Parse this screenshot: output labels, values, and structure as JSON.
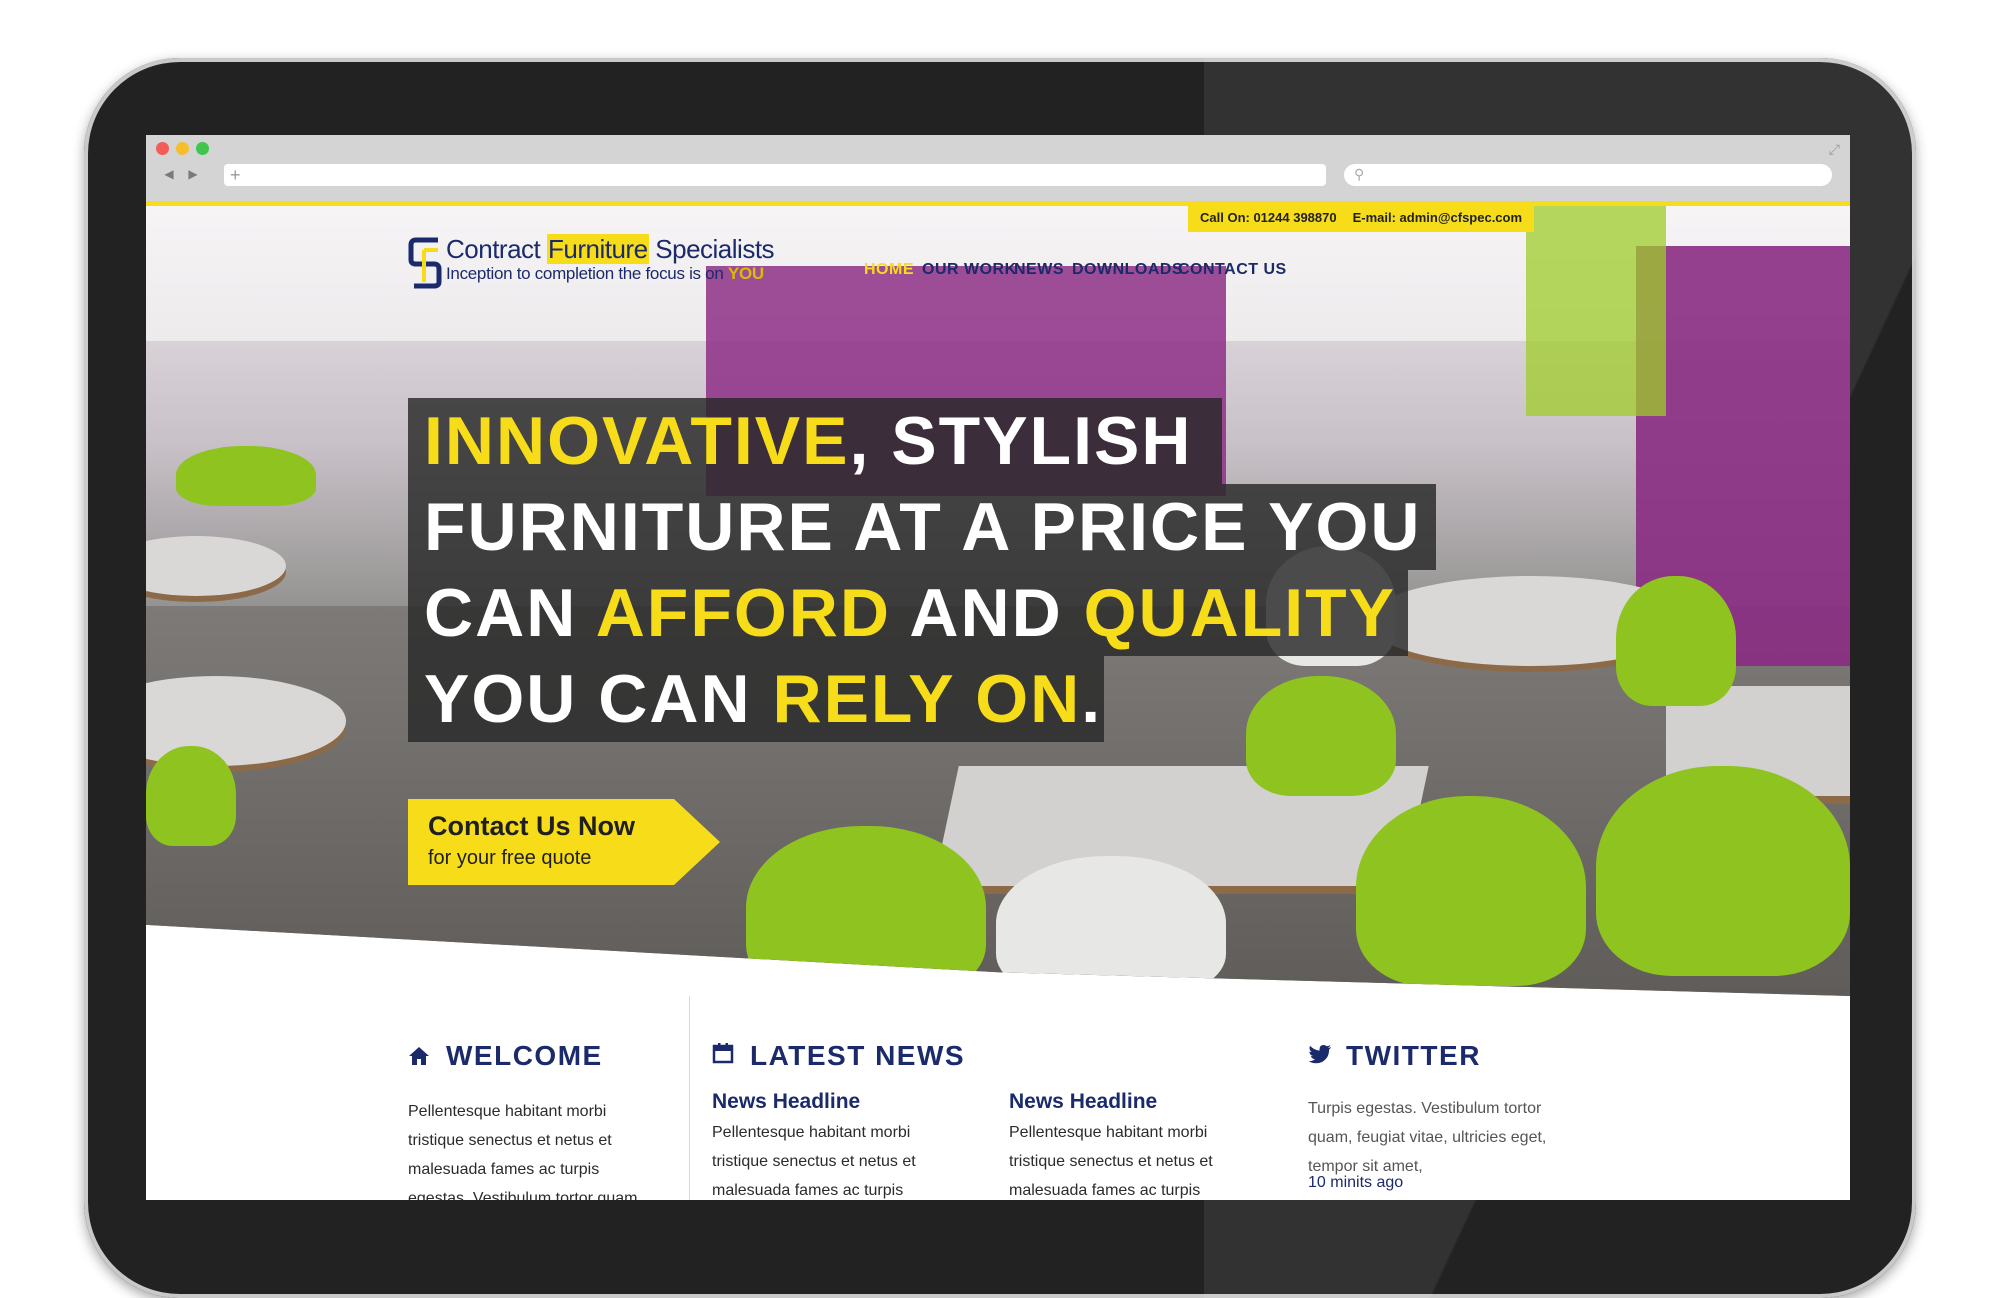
{
  "topbar": {
    "phone": "Call On: 01244 398870",
    "email": "E-mail: admin@cfspec.com"
  },
  "logo": {
    "name_part1": "Contract ",
    "name_highlight": "Furniture",
    "name_part2": " Specialists",
    "tagline_part1": "Inception to completion the focus is on ",
    "tagline_highlight": "YOU"
  },
  "nav": {
    "items": [
      {
        "label": "HOME",
        "active": true
      },
      {
        "label": "OUR WORK"
      },
      {
        "label": "NEWS"
      },
      {
        "label": "DOWNLOADS"
      },
      {
        "label": "CONTACT US"
      }
    ]
  },
  "hero": {
    "line1_y": "INNOVATIVE",
    "line1_w": ", STYLISH",
    "line2_w": "FURNITURE AT A PRICE YOU",
    "line3_w1": "CAN ",
    "line3_y1": "AFFORD",
    "line3_w2": " AND ",
    "line3_y2": "QUALITY",
    "line4_w": "YOU CAN ",
    "line4_y": "RELY ON",
    "line4_end": "."
  },
  "cta": {
    "title": "Contact Us Now",
    "subtitle": "for your free quote"
  },
  "welcome": {
    "title": "WELCOME",
    "text": "Pellentesque habitant morbi tristique senectus et netus et malesuada fames ac turpis egestas. Vestibulum tortor quam,"
  },
  "news": {
    "title": "LATEST NEWS",
    "items": [
      {
        "headline": "News Headline",
        "text": "Pellentesque habitant morbi tristique senectus et netus et malesuada fames ac turpis"
      },
      {
        "headline": "News Headline",
        "text": "Pellentesque habitant morbi tristique senectus et netus et malesuada fames ac turpis"
      }
    ]
  },
  "twitter": {
    "title": "TWITTER",
    "text": "Turpis egestas. Vestibulum tortor quam, feugiat vitae, ultricies eget, tempor sit amet,",
    "time": "10 minits ago"
  },
  "icons": {
    "welcome": "home-icon",
    "news": "calendar-icon",
    "twitter": "twitter-bird-icon"
  },
  "colors": {
    "brand_yellow": "#f7dd19",
    "brand_navy": "#1b2a6b"
  }
}
